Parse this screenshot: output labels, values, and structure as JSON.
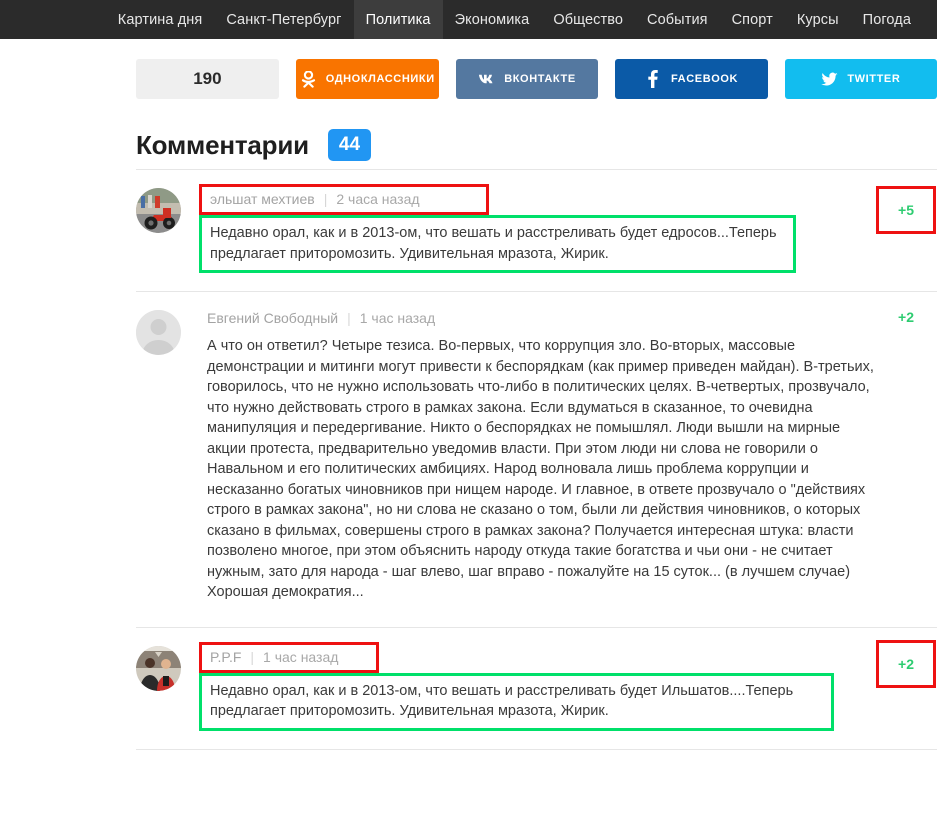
{
  "nav": {
    "items": [
      {
        "label": "Картина дня",
        "active": false
      },
      {
        "label": "Санкт-Петербург",
        "active": false
      },
      {
        "label": "Политика",
        "active": true
      },
      {
        "label": "Экономика",
        "active": false
      },
      {
        "label": "Общество",
        "active": false
      },
      {
        "label": "События",
        "active": false
      },
      {
        "label": "Спорт",
        "active": false
      },
      {
        "label": "Курсы",
        "active": false
      },
      {
        "label": "Погода",
        "active": false
      }
    ]
  },
  "share": {
    "count": "190",
    "odnoklassniki": "ОДНОКЛАССНИКИ",
    "vkontakte": "ВКОНТАКТЕ",
    "facebook": "FACEBOOK",
    "twitter": "TWITTER",
    "colors": {
      "odnoklassniki": "#f97400",
      "vkontakte": "#5478a0",
      "facebook": "#0b5aa7",
      "twitter": "#12bdef",
      "count_bg": "#efefef"
    }
  },
  "comments_section": {
    "title": "Комментарии",
    "count": "44",
    "badge_color": "#2196f3"
  },
  "comments": [
    {
      "author": "эльшат мехтиев",
      "separator": "|",
      "time": "2 часа назад",
      "text": "Недавно орал, как и в 2013-ом, что вешать и расстреливать будет едросов...Теперь предлагает приторомозить. Удивительная мразота, Жирик.",
      "score": "+5",
      "avatar": "motorcycle-photo-avatar"
    },
    {
      "author": "Евгений Свободный",
      "separator": "|",
      "time": "1 час назад",
      "text": "А что он ответил? Четыре тезиса. Во-первых, что коррупция зло. Во-вторых, массовые демонстрации и митинги могут привести к беспорядкам (как пример приведен майдан). В-третьих, говорилось, что не нужно использовать что-либо в политических целях. В-четвертых, прозвучало, что нужно действовать строго в рамках закона. Если вдуматься в сказанное, то очевидна манипуляция и передергивание. Никто о беспорядках не помышлял. Люди вышли на мирные акции протеста, предварительно уведомив власти. При этом люди ни слова не говорили о Навальном и его политических амбициях. Народ волновала лишь проблема коррупции и несказанно богатых чиновников при нищем народе. И главное, в ответе прозвучало о \"действиях строго в рамках закона\", но ни слова не сказано о том, были ли действия чиновников, о которых сказано в фильмах, совершены строго в рамках закона? Получается интересная штука: власти позволено многое, при этом объяснить народу откуда такие богатства и чьи они - не считает нужным, зато для народа - шаг влево, шаг вправо - пожалуйте на 15 суток... (в лучшем случае) Хорошая демократия...",
      "score": "+2",
      "avatar": "default-user-avatar"
    },
    {
      "author": "P.P.F",
      "separator": "|",
      "time": "1 час назад",
      "text": "Недавно орал, как и в 2013-ом, что вешать и расстреливать будет Ильшатов....Теперь предлагает приторомозить. Удивительная мразота, Жирик.",
      "score": "+2",
      "avatar": "two-men-photo-avatar"
    }
  ],
  "annotations": {
    "red_color": "#ee1111",
    "green_color": "#00e06a"
  }
}
